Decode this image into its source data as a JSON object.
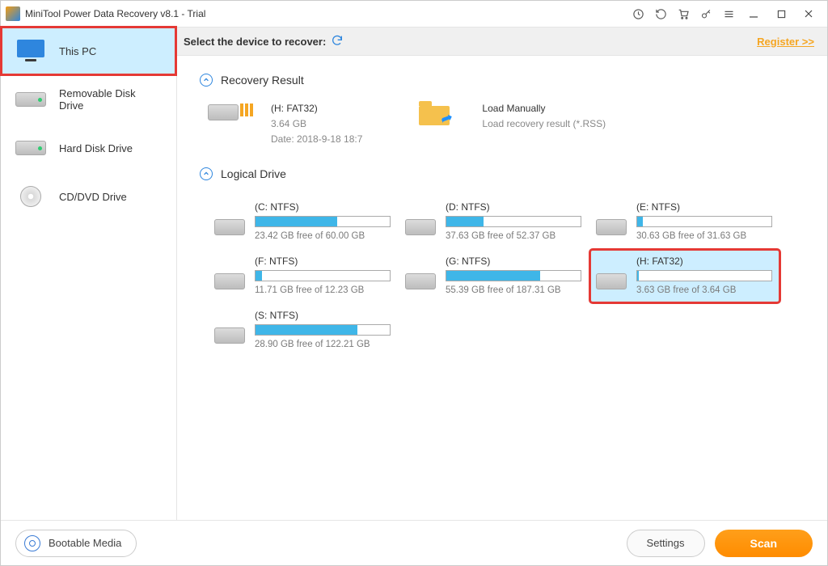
{
  "window": {
    "title": "MiniTool Power Data Recovery v8.1 - Trial"
  },
  "subheader": {
    "label": "Select the device to recover:",
    "register": "Register >>"
  },
  "sidebar": {
    "items": [
      {
        "label": "This PC",
        "icon": "monitor-icon",
        "active": true
      },
      {
        "label": "Removable Disk Drive",
        "icon": "removable-drive-icon"
      },
      {
        "label": "Hard Disk Drive",
        "icon": "hard-drive-icon"
      },
      {
        "label": "CD/DVD Drive",
        "icon": "disc-icon"
      }
    ]
  },
  "sections": {
    "recovery": {
      "heading": "Recovery Result",
      "card": {
        "name": "(H: FAT32)",
        "size": "3.64 GB",
        "date": "Date: 2018-9-18 18:7"
      },
      "manual": {
        "title": "Load Manually",
        "subtitle": "Load recovery result (*.RSS)"
      }
    },
    "logical": {
      "heading": "Logical Drive",
      "drives": [
        {
          "name": "(C: NTFS)",
          "free": "23.42 GB free of 60.00 GB",
          "pct": 61
        },
        {
          "name": "(D: NTFS)",
          "free": "37.63 GB free of 52.37 GB",
          "pct": 28
        },
        {
          "name": "(E: NTFS)",
          "free": "30.63 GB free of 31.63 GB",
          "pct": 4
        },
        {
          "name": "(F: NTFS)",
          "free": "11.71 GB free of 12.23 GB",
          "pct": 5
        },
        {
          "name": "(G: NTFS)",
          "free": "55.39 GB free of 187.31 GB",
          "pct": 70
        },
        {
          "name": "(H: FAT32)",
          "free": "3.63 GB free of 3.64 GB",
          "pct": 1,
          "selected": true
        },
        {
          "name": "(S: NTFS)",
          "free": "28.90 GB free of 122.21 GB",
          "pct": 76
        }
      ]
    }
  },
  "footer": {
    "bootable": "Bootable Media",
    "settings": "Settings",
    "scan": "Scan"
  }
}
